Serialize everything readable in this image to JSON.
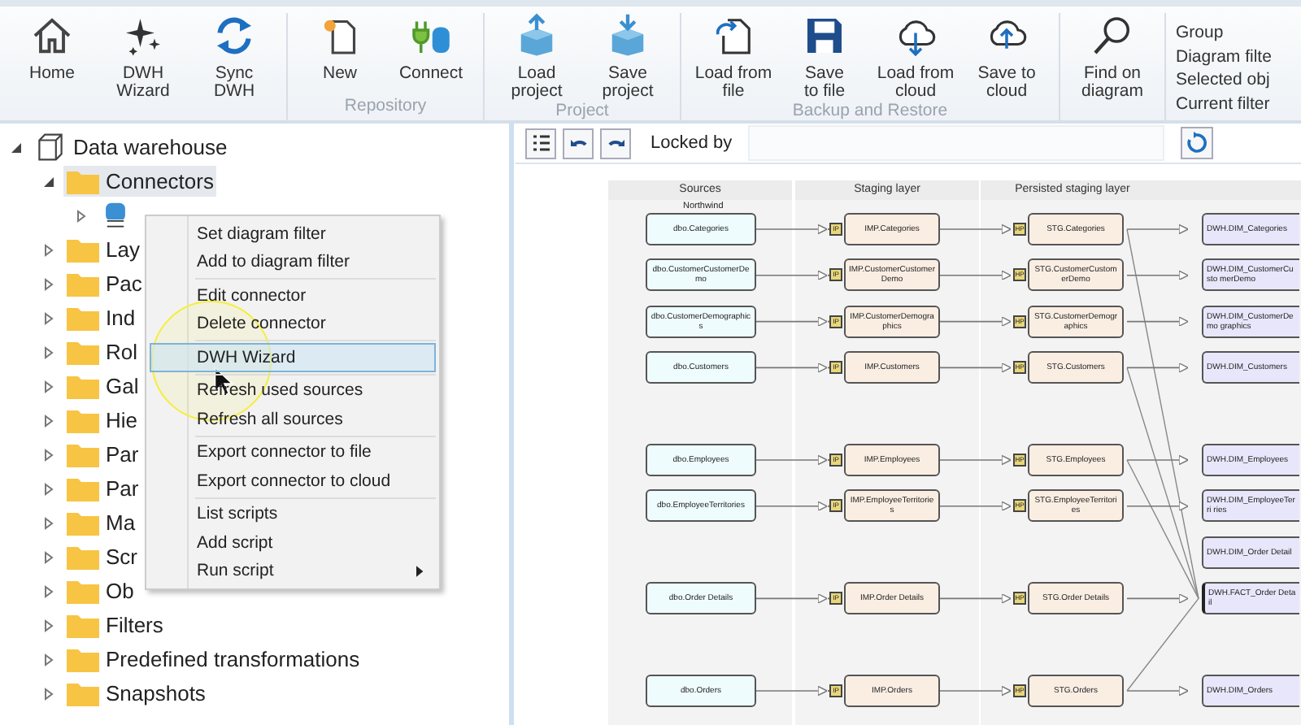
{
  "ribbon": {
    "groups": [
      {
        "buttons": [
          {
            "kind": "home",
            "lines": [
              "Home"
            ]
          },
          {
            "kind": "sparkle",
            "lines": [
              "DWH",
              "Wizard"
            ]
          },
          {
            "kind": "sync",
            "lines": [
              "Sync",
              "DWH"
            ]
          }
        ]
      },
      {
        "label": "Repository",
        "buttons": [
          {
            "kind": "new",
            "lines": [
              "New"
            ]
          },
          {
            "kind": "connect",
            "lines": [
              "Connect"
            ]
          }
        ]
      },
      {
        "label": "Project",
        "buttons": [
          {
            "kind": "box-up",
            "lines": [
              "Load",
              "project"
            ]
          },
          {
            "kind": "box-down",
            "lines": [
              "Save",
              "project"
            ]
          }
        ]
      },
      {
        "label": "Backup and Restore",
        "buttons": [
          {
            "kind": "file-load",
            "lines": [
              "Load from",
              "file"
            ]
          },
          {
            "kind": "floppy",
            "lines": [
              "Save",
              "to file"
            ]
          },
          {
            "kind": "cloud-down",
            "lines": [
              "Load from",
              "cloud"
            ]
          },
          {
            "kind": "cloud-up",
            "lines": [
              "Save to",
              "cloud"
            ]
          }
        ]
      },
      {
        "buttons": [
          {
            "kind": "find",
            "lines": [
              "Find on",
              "diagram"
            ]
          }
        ]
      }
    ],
    "side_options": [
      "Group",
      "Diagram filte",
      "Selected obj",
      "Current filter"
    ]
  },
  "tree": [
    {
      "label": "Data warehouse",
      "kind": "warehouse",
      "expanded": true,
      "selected": false,
      "children": [
        {
          "label": "Connectors",
          "kind": "folder",
          "expanded": true,
          "selected": true,
          "children": [
            {
              "kind": "sql",
              "expanded": false,
              "selected": false
            }
          ]
        },
        {
          "label": "Lay",
          "kind": "folder",
          "expanded": false,
          "selected": false
        },
        {
          "label": "Pac",
          "kind": "folder",
          "expanded": false,
          "selected": false
        },
        {
          "label": "Ind",
          "kind": "folder",
          "expanded": false,
          "selected": false
        },
        {
          "label": "Rol",
          "kind": "folder",
          "expanded": false,
          "selected": false
        },
        {
          "label": "Gal",
          "kind": "folder",
          "expanded": false,
          "selected": false
        },
        {
          "label": "Hie",
          "kind": "folder",
          "expanded": false,
          "selected": false
        },
        {
          "label": "Par",
          "kind": "folder",
          "expanded": false,
          "selected": false
        },
        {
          "label": "Par",
          "kind": "folder",
          "expanded": false,
          "selected": false
        },
        {
          "label": "Ma",
          "kind": "folder",
          "expanded": false,
          "selected": false
        },
        {
          "label": "Scr",
          "kind": "folder",
          "expanded": false,
          "selected": false
        },
        {
          "label": "Ob",
          "kind": "folder",
          "expanded": false,
          "selected": false
        },
        {
          "label": "Filters",
          "kind": "folder",
          "expanded": false,
          "selected": false
        },
        {
          "label": "Predefined transformations",
          "kind": "folder",
          "expanded": false,
          "selected": false
        },
        {
          "label": "Snapshots",
          "kind": "folder",
          "expanded": false,
          "selected": false
        }
      ]
    }
  ],
  "context_menu": {
    "sections": [
      [
        {
          "label": "Set diagram filter",
          "selected": false,
          "has_submenu": false
        },
        {
          "label": "Add to diagram filter",
          "selected": false,
          "has_submenu": false
        }
      ],
      [
        {
          "label": "Edit connector",
          "selected": false,
          "has_submenu": false
        },
        {
          "label": "Delete connector",
          "selected": false,
          "has_submenu": false
        }
      ],
      [
        {
          "label": "DWH Wizard",
          "selected": true,
          "has_submenu": false
        }
      ],
      [
        {
          "label": "Refresh used sources",
          "selected": false,
          "has_submenu": false
        },
        {
          "label": "Refresh all sources",
          "selected": false,
          "has_submenu": false
        }
      ],
      [
        {
          "label": "Export connector to file",
          "selected": false,
          "has_submenu": false
        },
        {
          "label": "Export connector to cloud",
          "selected": false,
          "has_submenu": false
        }
      ],
      [
        {
          "label": "List scripts",
          "selected": false,
          "has_submenu": false
        },
        {
          "label": "Add script",
          "selected": false,
          "has_submenu": false
        },
        {
          "label": "Run script",
          "selected": false,
          "has_submenu": true
        }
      ]
    ]
  },
  "diagram_toolbar": {
    "locked_by_label": "Locked by"
  },
  "diagram": {
    "columns": [
      "Sources",
      "Staging layer",
      "Persisted staging layer"
    ],
    "source_group": "Northwind",
    "rows": [
      {
        "source": "dbo.Categories",
        "staging": "IMP.Categories",
        "staging_badge": "IP",
        "persisted": "STG.Categories",
        "persisted_badge": "HP",
        "dwh": "DWH.DIM_Categories",
        "feeds_fact": true
      },
      {
        "source": "dbo.CustomerCustomerDemo",
        "staging": "IMP.CustomerCustomerDemo",
        "staging_badge": "IP",
        "persisted": "STG.CustomerCustomerDemo",
        "persisted_badge": "HP",
        "dwh": "DWH.DIM_CustomerCusto merDemo"
      },
      {
        "source": "dbo.CustomerDemographics",
        "staging": "IMP.CustomerDemographics",
        "staging_badge": "IP",
        "persisted": "STG.CustomerDemographics",
        "persisted_badge": "HP",
        "dwh": "DWH.DIM_CustomerDemo graphics"
      },
      {
        "source": "dbo.Customers",
        "staging": "IMP.Customers",
        "staging_badge": "IP",
        "persisted": "STG.Customers",
        "persisted_badge": "HP",
        "dwh": "DWH.DIM_Customers",
        "feeds_fact": true
      },
      {
        "gap_before": true,
        "source": "dbo.Employees",
        "staging": "IMP.Employees",
        "staging_badge": "IP",
        "persisted": "STG.Employees",
        "persisted_badge": "HP",
        "dwh": "DWH.DIM_Employees",
        "feeds_fact": true
      },
      {
        "source": "dbo.EmployeeTerritories",
        "staging": "IMP.EmployeeTerritories",
        "staging_badge": "IP",
        "persisted": "STG.EmployeeTerritories",
        "persisted_badge": "HP",
        "dwh": "DWH.DIM_EmployeeTerri ries"
      },
      {
        "dwh": "DWH.DIM_Order Detail"
      },
      {
        "source": "dbo.Order Details",
        "staging": "IMP.Order Details",
        "staging_badge": "IP",
        "persisted": "STG.Order Details",
        "persisted_badge": "HP",
        "dwh": "DWH.FACT_Order Detail",
        "is_fact": true
      },
      {
        "gap_before": true,
        "source": "dbo.Orders",
        "staging": "IMP.Orders",
        "staging_badge": "IP",
        "persisted": "STG.Orders",
        "persisted_badge": "HP",
        "dwh": "DWH.DIM_Orders",
        "feeds_fact": true
      }
    ]
  }
}
